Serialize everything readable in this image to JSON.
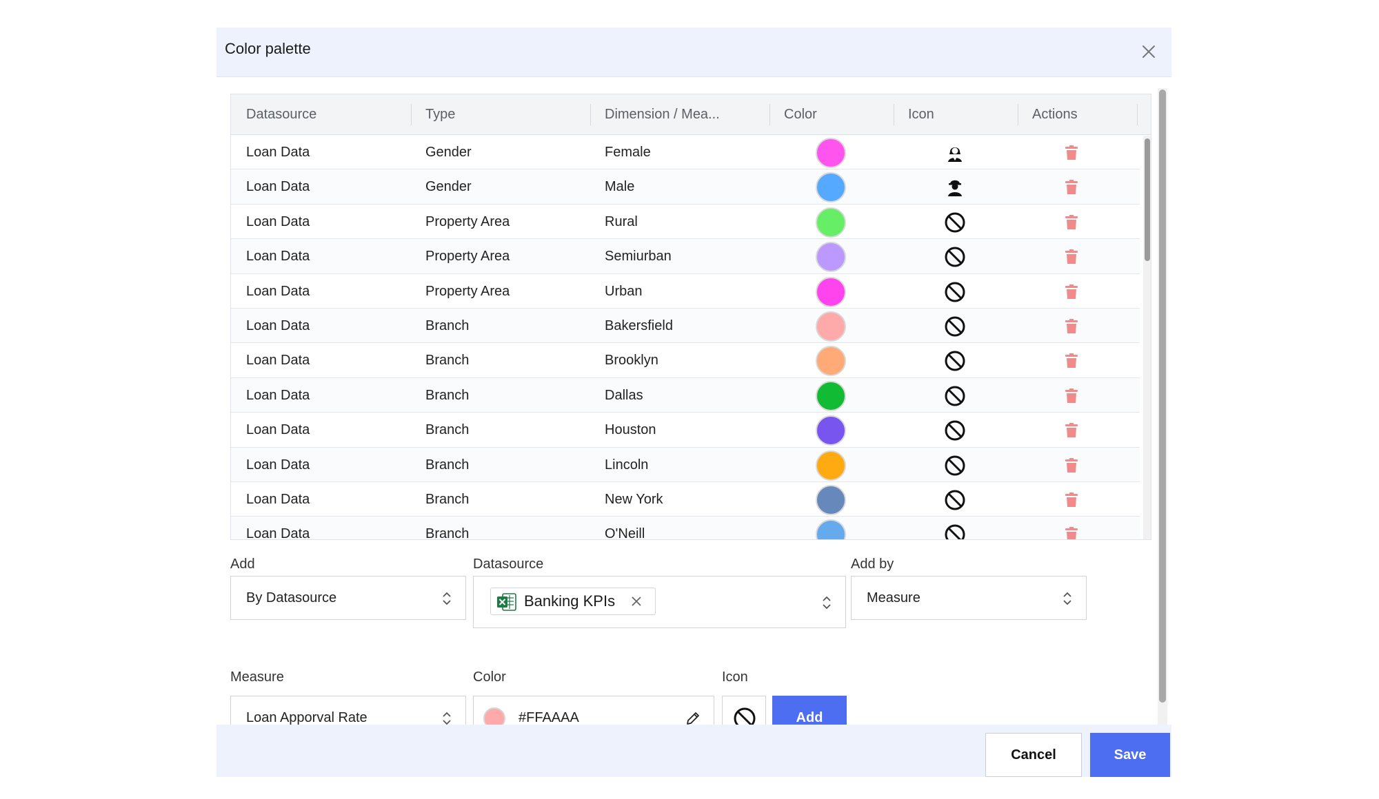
{
  "dialog": {
    "title": "Color palette"
  },
  "table": {
    "columns": [
      "Datasource",
      "Type",
      "Dimension / Mea...",
      "Color",
      "Icon",
      "Actions"
    ],
    "rows": [
      {
        "datasource": "Loan Data",
        "type": "Gender",
        "dimension": "Female",
        "color": "#FF55EE",
        "icon": "female-person-icon"
      },
      {
        "datasource": "Loan Data",
        "type": "Gender",
        "dimension": "Male",
        "color": "#55AAFF",
        "icon": "male-worker-icon"
      },
      {
        "datasource": "Loan Data",
        "type": "Property Area",
        "dimension": "Rural",
        "color": "#66EE66",
        "icon": "no-symbol-icon"
      },
      {
        "datasource": "Loan Data",
        "type": "Property Area",
        "dimension": "Semiurban",
        "color": "#BB99FF",
        "icon": "no-symbol-icon"
      },
      {
        "datasource": "Loan Data",
        "type": "Property Area",
        "dimension": "Urban",
        "color": "#FF44EE",
        "icon": "no-symbol-icon"
      },
      {
        "datasource": "Loan Data",
        "type": "Branch",
        "dimension": "Bakersfield",
        "color": "#FFAAAA",
        "icon": "no-symbol-icon"
      },
      {
        "datasource": "Loan Data",
        "type": "Branch",
        "dimension": "Brooklyn",
        "color": "#FFAA77",
        "icon": "no-symbol-icon"
      },
      {
        "datasource": "Loan Data",
        "type": "Branch",
        "dimension": "Dallas",
        "color": "#11BB33",
        "icon": "no-symbol-icon"
      },
      {
        "datasource": "Loan Data",
        "type": "Branch",
        "dimension": "Houston",
        "color": "#7755EE",
        "icon": "no-symbol-icon"
      },
      {
        "datasource": "Loan Data",
        "type": "Branch",
        "dimension": "Lincoln",
        "color": "#FFAA11",
        "icon": "no-symbol-icon"
      },
      {
        "datasource": "Loan Data",
        "type": "Branch",
        "dimension": "New York",
        "color": "#6688BB",
        "icon": "no-symbol-icon"
      },
      {
        "datasource": "Loan Data",
        "type": "Branch",
        "dimension": "O'Neill",
        "color": "#66AAEE",
        "icon": "no-symbol-icon"
      }
    ]
  },
  "form": {
    "add": {
      "label": "Add",
      "value": "By Datasource"
    },
    "datasource": {
      "label": "Datasource",
      "chip": "Banking KPIs"
    },
    "add_by": {
      "label": "Add by",
      "value": "Measure"
    },
    "measure": {
      "label": "Measure",
      "value": "Loan Apporval Rate"
    },
    "color": {
      "label": "Color",
      "value": "#FFAAAA"
    },
    "icon": {
      "label": "Icon",
      "value": "no-symbol-icon"
    },
    "add_button": "Add"
  },
  "footer": {
    "cancel": "Cancel",
    "save": "Save"
  }
}
